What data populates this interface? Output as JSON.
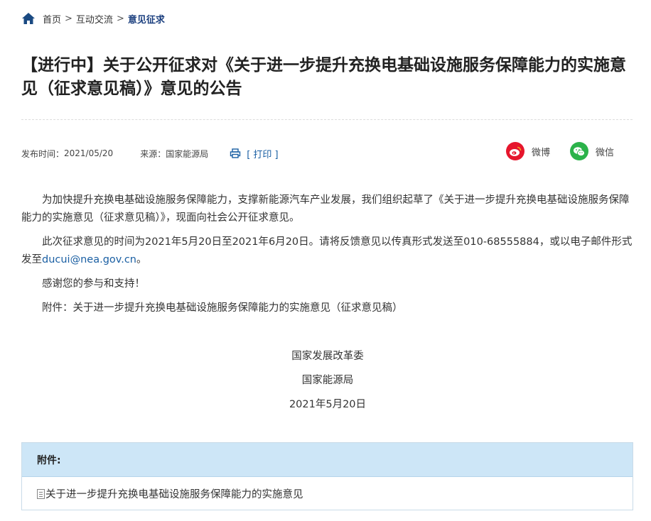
{
  "breadcrumb": {
    "home": "首页",
    "section": "互动交流",
    "current": "意见征求",
    "separator": ">"
  },
  "title": "【进行中】关于公开征求对《关于进一步提升充换电基础设施服务保障能力的实施意见（征求意见稿）》意见的公告",
  "meta": {
    "publish_label": "发布时间：",
    "publish_date": "2021/05/20",
    "source_label": "来源：",
    "source": "国家能源局",
    "print": "[ 打印 ]"
  },
  "share": {
    "weibo": "微博",
    "wechat": "微信",
    "weibo_color": "#e6162d",
    "wechat_color": "#2bb34a"
  },
  "content": {
    "p1": "为加快提升充换电基础设施服务保障能力，支撑新能源汽车产业发展，我们组织起草了《关于进一步提升充换电基础设施服务保障能力的实施意见（征求意见稿）》，现面向社会公开征求意见。",
    "p2_text": "此次征求意见的时间为2021年5月20日至2021年6月20日。请将反馈意见以传真形式发送至010-68555884，或以电子邮件形式发至",
    "p2_email": "ducui@nea.gov.cn",
    "p2_end": "。",
    "p3": "感谢您的参与和支持！",
    "p4": "附件：关于进一步提升充换电基础设施服务保障能力的实施意见（征求意见稿）"
  },
  "signature": {
    "org1": "国家发展改革委",
    "org2": "国家能源局",
    "date": "2021年5月20日"
  },
  "attachments": {
    "header": "附件:",
    "items": [
      {
        "label": "关于进一步提升充换电基础设施服务保障能力的实施意见"
      }
    ]
  },
  "colors": {
    "accent": "#1a5fa3",
    "breadcrumb_current": "#1a3e7e",
    "attach_header_bg": "#cde6f7"
  }
}
